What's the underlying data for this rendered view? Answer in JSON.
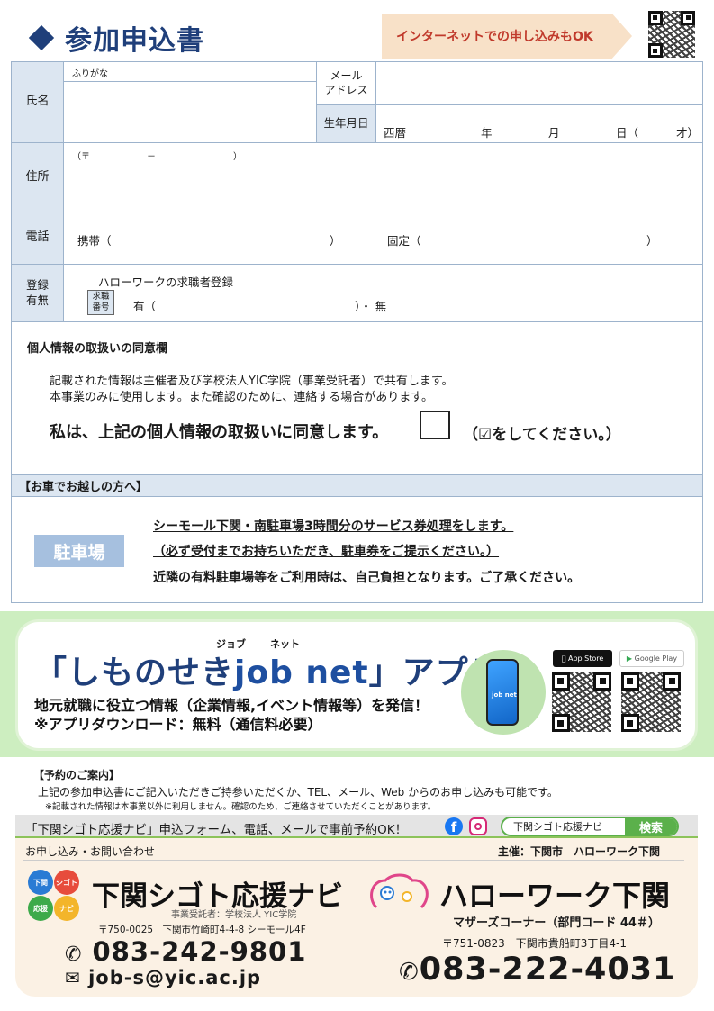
{
  "header": {
    "title": "参加申込書",
    "internet_note": "インターネットでの申し込みもOK"
  },
  "form": {
    "name_label": "氏名",
    "furigana": "ふりがな",
    "email_label_1": "メール",
    "email_label_2": "アドレス",
    "dob_label": "生年月日",
    "dob_era": "西暦",
    "dob_year": "年",
    "dob_month": "月",
    "dob_day": "日（",
    "dob_age": "才）",
    "address_label": "住所",
    "postal_open": "（〒",
    "postal_dash": "－",
    "postal_close": "）",
    "phone_label": "電話",
    "mobile": "携帯（",
    "mobile_close": "）",
    "landline": "固定（",
    "landline_close": "）",
    "reg_label_1": "登録",
    "reg_label_2": "有無",
    "hw_reg": "ハローワークの求職者登録",
    "job_num_1": "求職",
    "job_num_2": "番号",
    "yes": "有（",
    "no": "）・ 無"
  },
  "consent": {
    "title": "個人情報の取扱いの同意欄",
    "line1": "記載された情報は主催者及び学校法人YIC学院（事業受託者）で共有します。",
    "line2": "本事業のみに使用します。また確認のために、連絡する場合があります。",
    "statement": "私は、上記の個人情報の取扱いに同意します。",
    "check_note": "（☑をしてください。）"
  },
  "parking": {
    "header": "【お車でお越しの方へ】",
    "badge": "駐車場",
    "line1": "シーモール下関・南駐車場3時間分のサービス券処理をします。",
    "line2": "（必ず受付までお持ちいただき、駐車券をご提示ください。）",
    "line3": "近隣の有料駐車場等をご利用時は、自己負担となります。ご了承ください。"
  },
  "app": {
    "ruby_job": "ジョブ",
    "ruby_net": "ネット",
    "title_open": "「しものせき",
    "title_brand": "job net",
    "title_close": "」アプリ",
    "line1": "地元就職に役立つ情報（企業情報,イベント情報等）を発信！",
    "line2": "※アプリダウンロード：無料（通信料必要）",
    "phone_label": "job net",
    "app_store": "App Store",
    "google_play": "Google Play"
  },
  "reservation": {
    "title": "【予約のご案内】",
    "line1": "上記の参加申込書にご記入いただきご持参いただくか、TEL、メール、Web からのお申し込みも可能です。",
    "note": "※記載された情報は本事業以外に利用しません。確認のため、ご連絡させていただくことがあります。"
  },
  "contact": {
    "bar_text": "「下関シゴト応援ナビ」申込フォーム、電話、メールで事前予約OK！",
    "search_label": "下関シゴト応援ナビ",
    "search_btn": "検索",
    "inquiry": "お申し込み・お問い合わせ",
    "host": "主催：下関市　ハローワーク下関",
    "navi_logo": [
      "下関",
      "シゴト",
      "応援",
      "ナビ"
    ],
    "navi_name": "下関シゴト応援ナビ",
    "navi_sub": "事業受託者：学校法人 YIC学院",
    "navi_addr": "〒750-0025　下関市竹崎町4-4-8 シーモール4F",
    "navi_tel": "083-242-9801",
    "navi_mail": "job-s@yic.ac.jp",
    "hw_name": "ハローワーク下関",
    "hw_corner": "マザーズコーナー（部門コード 44＃）",
    "hw_addr": "〒751-0823　下関市貴船町3丁目4-1",
    "hw_tel": "083-222-4031"
  }
}
